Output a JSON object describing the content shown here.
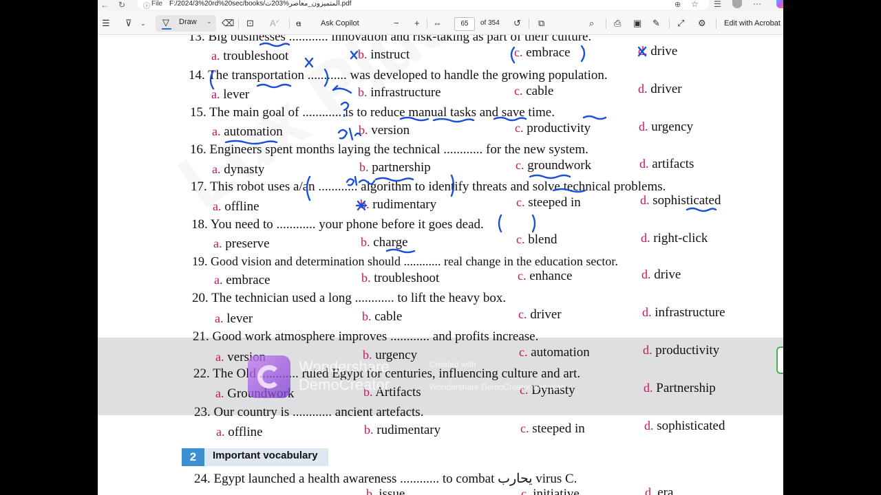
{
  "browser": {
    "file_label": "File",
    "url": "F:/2024/3%20rd%20sec/books/المتميزون_معاصر%203ت.pdf"
  },
  "toolbar": {
    "draw_label": "Draw",
    "ask_copilot": "Ask Copilot",
    "zoom_minus": "−",
    "zoom_plus": "+",
    "page_current": "65",
    "page_total": "of 354",
    "edit_with_acrobat": "Edit with Acrobat"
  },
  "questions": [
    {
      "num": "13.",
      "stem": "Big businesses ............ innovation and risk-taking as part of their culture.",
      "options": [
        {
          "letter": "a.",
          "text": "troubleshoot"
        },
        {
          "letter": "b.",
          "text": "instruct"
        },
        {
          "letter": "c.",
          "text": "embrace"
        },
        {
          "letter": "d.",
          "text": "drive"
        }
      ]
    },
    {
      "num": "14.",
      "stem": "The transportation ............ was developed to handle the growing population.",
      "options": [
        {
          "letter": "a.",
          "text": "lever"
        },
        {
          "letter": "b.",
          "text": "infrastructure"
        },
        {
          "letter": "c.",
          "text": "cable"
        },
        {
          "letter": "d.",
          "text": "driver"
        }
      ]
    },
    {
      "num": "15.",
      "stem": "The main goal of ............ is to reduce manual tasks and save time.",
      "options": [
        {
          "letter": "a.",
          "text": "automation"
        },
        {
          "letter": "b.",
          "text": "version"
        },
        {
          "letter": "c.",
          "text": "productivity"
        },
        {
          "letter": "d.",
          "text": "urgency"
        }
      ]
    },
    {
      "num": "16.",
      "stem": "Engineers spent months laying the technical ............ for the new system.",
      "options": [
        {
          "letter": "a.",
          "text": "dynasty"
        },
        {
          "letter": "b.",
          "text": "partnership"
        },
        {
          "letter": "c.",
          "text": "groundwork"
        },
        {
          "letter": "d.",
          "text": "artifacts"
        }
      ]
    },
    {
      "num": "17.",
      "stem": "This robot uses a/an ............ algorithm to identify threats and solve technical problems.",
      "options": [
        {
          "letter": "a.",
          "text": "offline"
        },
        {
          "letter": "b.",
          "text": "rudimentary"
        },
        {
          "letter": "c.",
          "text": "steeped in"
        },
        {
          "letter": "d.",
          "text": "sophisticated"
        }
      ]
    },
    {
      "num": "18.",
      "stem": "You need to ............ your phone before it goes dead.",
      "options": [
        {
          "letter": "a.",
          "text": "preserve"
        },
        {
          "letter": "b.",
          "text": "charge"
        },
        {
          "letter": "c.",
          "text": "blend"
        },
        {
          "letter": "d.",
          "text": "right-click"
        }
      ]
    },
    {
      "num": "19.",
      "stem": "Good vision and determination should ............ real change in the education sector.",
      "options": [
        {
          "letter": "a.",
          "text": "embrace"
        },
        {
          "letter": "b.",
          "text": "troubleshoot"
        },
        {
          "letter": "c.",
          "text": "enhance"
        },
        {
          "letter": "d.",
          "text": "drive"
        }
      ]
    },
    {
      "num": "20.",
      "stem": "The technician used a long ............ to lift the heavy box.",
      "options": [
        {
          "letter": "a.",
          "text": "lever"
        },
        {
          "letter": "b.",
          "text": "cable"
        },
        {
          "letter": "c.",
          "text": "driver"
        },
        {
          "letter": "d.",
          "text": "infrastructure"
        }
      ]
    },
    {
      "num": "21.",
      "stem": "Good work atmosphere improves ............ and profits increase.",
      "options": [
        {
          "letter": "a.",
          "text": "version"
        },
        {
          "letter": "b.",
          "text": "urgency"
        },
        {
          "letter": "c.",
          "text": "automation"
        },
        {
          "letter": "d.",
          "text": "productivity"
        }
      ]
    },
    {
      "num": "22.",
      "stem": "The Old ............ ruled Egypt for centuries, influencing culture and art.",
      "options": [
        {
          "letter": "a.",
          "text": "Groundwork"
        },
        {
          "letter": "b.",
          "text": "Artifacts"
        },
        {
          "letter": "c.",
          "text": "Dynasty"
        },
        {
          "letter": "d.",
          "text": "Partnership"
        }
      ]
    },
    {
      "num": "23.",
      "stem": "Our country is ............ ancient artefacts.",
      "options": [
        {
          "letter": "a.",
          "text": "offline"
        },
        {
          "letter": "b.",
          "text": "rudimentary"
        },
        {
          "letter": "c.",
          "text": "steeped in"
        },
        {
          "letter": "d.",
          "text": "sophisticated"
        }
      ]
    }
  ],
  "section": {
    "number": "2",
    "title": "Important vocabulary"
  },
  "q24": {
    "num": "24.",
    "stem": "Egypt launched a health awareness ............ to combat يحارب virus C.",
    "options": [
      {
        "letter": "b.",
        "text": "issue"
      },
      {
        "letter": "c.",
        "text": "initiative"
      },
      {
        "letter": "d.",
        "text": "era"
      }
    ]
  },
  "overlay": {
    "brand": "Wondershare",
    "product": "DemoCreator",
    "created_with": "Created with",
    "free_plan": "Wondershare DemoCreator free plan"
  },
  "ink_color": "#1a4fd6"
}
